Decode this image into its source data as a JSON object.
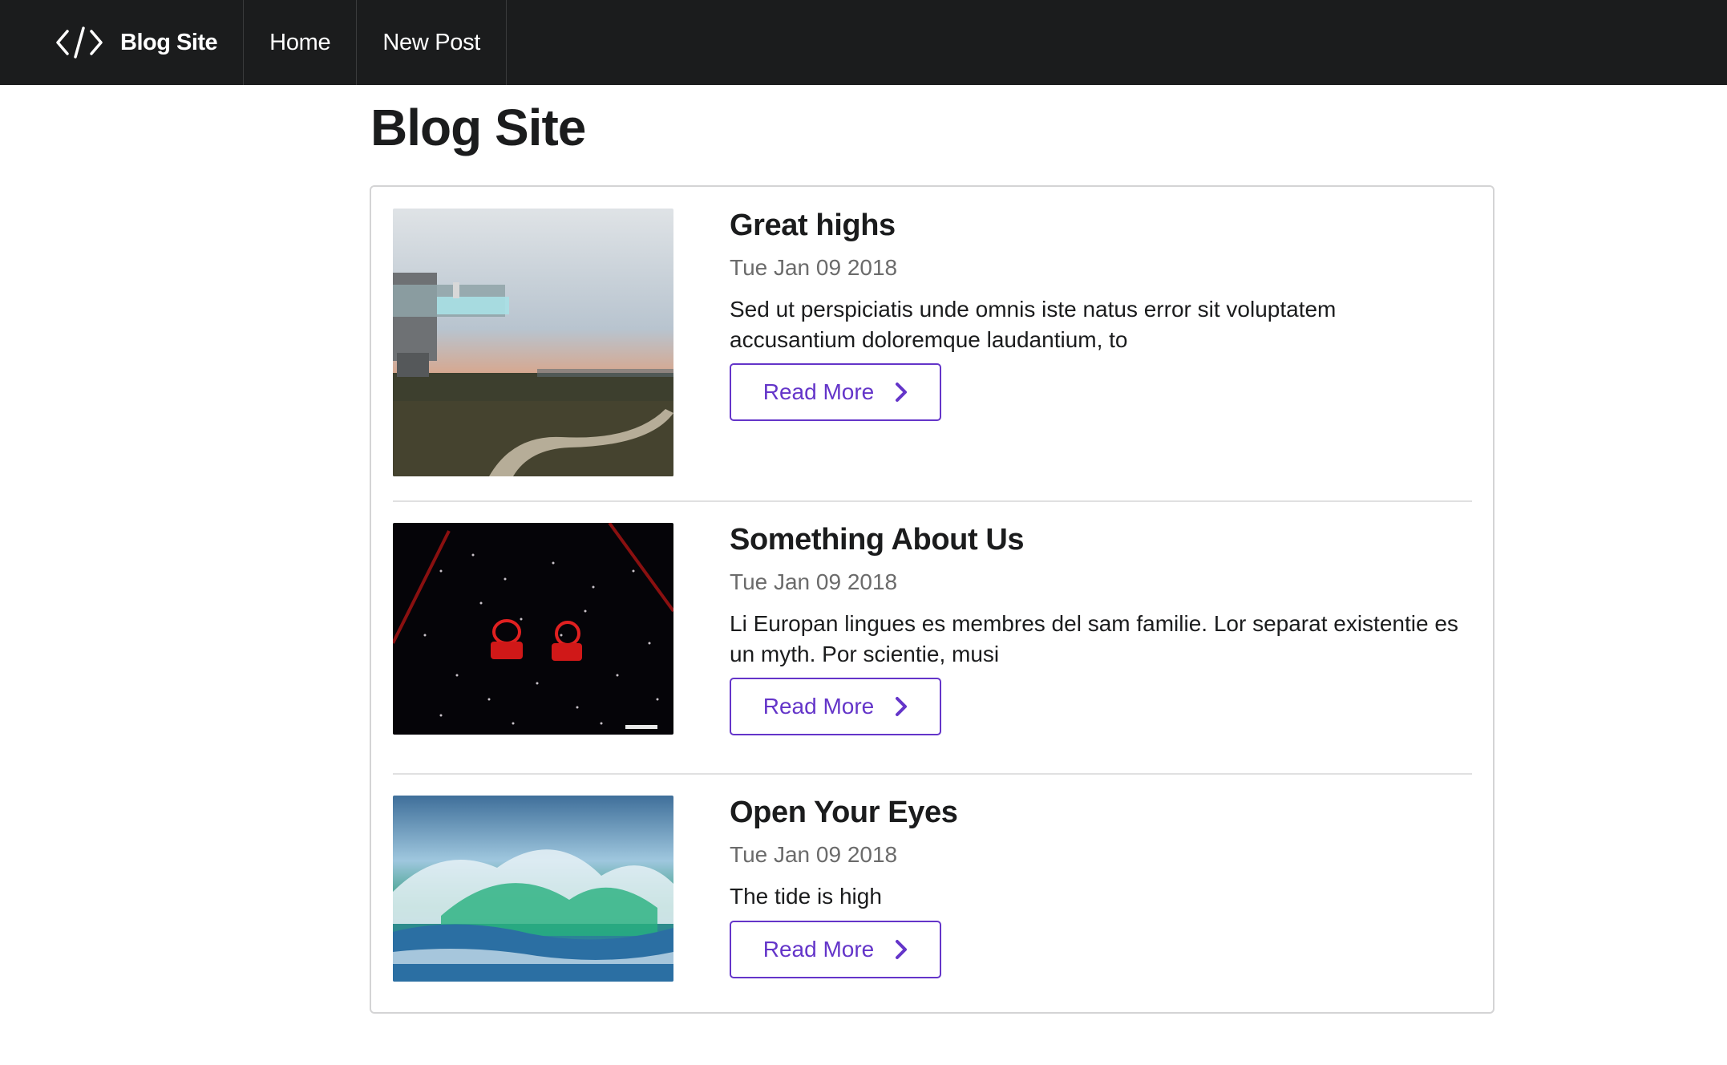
{
  "nav": {
    "brand_label": "Blog Site",
    "brand_icon": "code-icon",
    "items": [
      {
        "label": "Home"
      },
      {
        "label": "New Post"
      }
    ]
  },
  "page": {
    "title": "Blog Site"
  },
  "posts": [
    {
      "title": "Great highs",
      "date": "Tue Jan 09 2018",
      "excerpt": "Sed ut perspiciatis unde omnis iste natus error sit voluptatem accusantium doloremque laudantium, to",
      "button_label": "Read More",
      "button_icon": "chevron-right-icon"
    },
    {
      "title": "Something About Us",
      "date": "Tue Jan 09 2018",
      "excerpt": "Li Europan lingues es membres del sam familie. Lor separat existentie es un myth. Por scientie, musi",
      "button_label": "Read More",
      "button_icon": "chevron-right-icon"
    },
    {
      "title": "Open Your Eyes",
      "date": "Tue Jan 09 2018",
      "excerpt": "The tide is high",
      "button_label": "Read More",
      "button_icon": "chevron-right-icon"
    }
  ],
  "colors": {
    "navbar_bg": "#1b1c1d",
    "accent": "#6435c9",
    "date_text": "#6b6b6b",
    "border": "#d4d4d5"
  }
}
